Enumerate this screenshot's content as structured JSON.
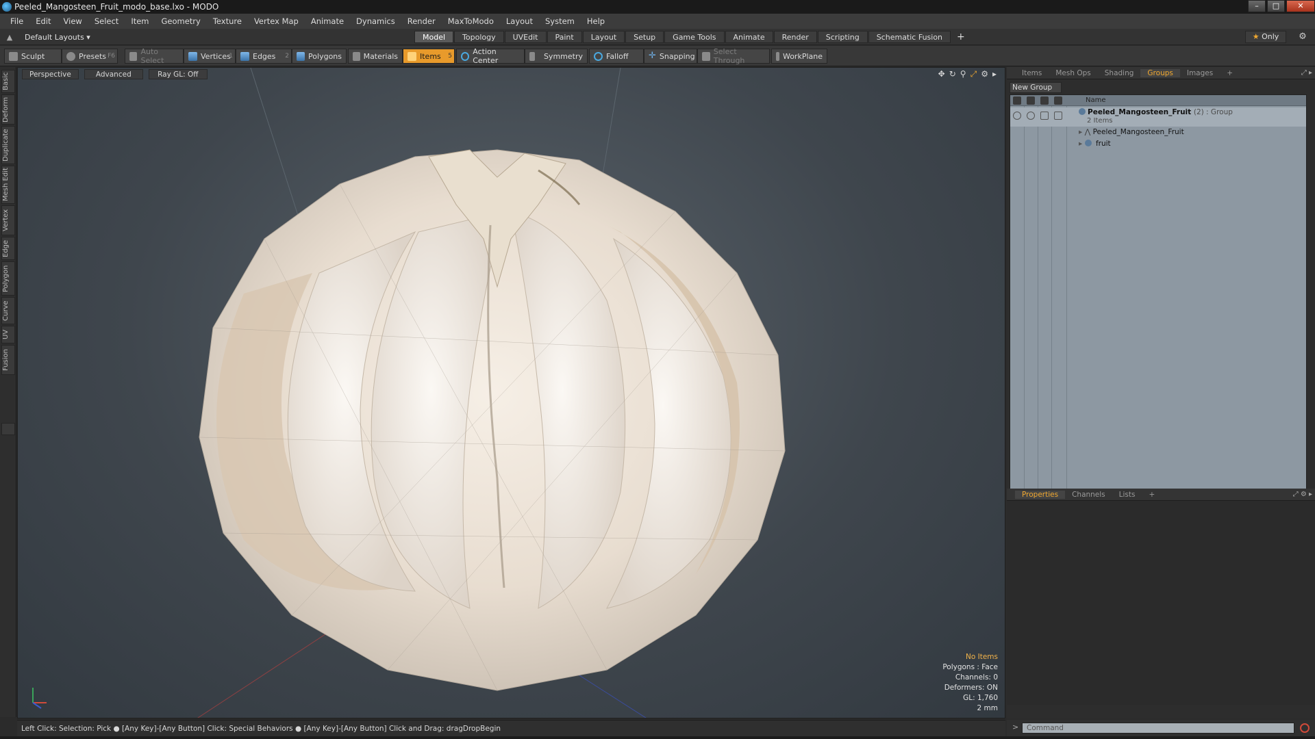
{
  "window": {
    "title": "Peeled_Mangosteen_Fruit_modo_base.lxo - MODO",
    "minimize": "–",
    "maximize": "□",
    "close": "✕"
  },
  "menu": [
    "File",
    "Edit",
    "View",
    "Select",
    "Item",
    "Geometry",
    "Texture",
    "Vertex Map",
    "Animate",
    "Dynamics",
    "Render",
    "MaxToModo",
    "Layout",
    "System",
    "Help"
  ],
  "layout": {
    "dropdown": "Default Layouts ▾",
    "tabs": [
      "Model",
      "Topology",
      "UVEdit",
      "Paint",
      "Layout",
      "Setup",
      "Game Tools",
      "Animate",
      "Render",
      "Scripting",
      "Schematic Fusion"
    ],
    "active_tab": "Model",
    "plus": "+",
    "only": "Only",
    "only_star": "★",
    "gear": "⚙"
  },
  "toolbar": {
    "sculpt": "Sculpt",
    "presets": "Presets",
    "presets_key": "F6",
    "auto_select": "Auto Select",
    "vertices": "Vertices",
    "vertices_num": "1",
    "edges": "Edges",
    "edges_num": "2",
    "polygons": "Polygons",
    "materials": "Materials",
    "items": "Items",
    "items_num": "5",
    "action_center": "Action Center",
    "symmetry": "Symmetry",
    "falloff": "Falloff",
    "snapping": "Snapping",
    "select_through": "Select Through",
    "workplane": "WorkPlane"
  },
  "left_tabs": [
    "Basic",
    "Deform",
    "Duplicate",
    "Mesh Edit",
    "Vertex",
    "Edge",
    "Polygon",
    "Curve",
    "UV",
    "Fusion"
  ],
  "viewport": {
    "view": "Perspective",
    "shading": "Advanced",
    "raygl": "Ray GL: Off",
    "info": {
      "no_items": "No Items",
      "polygons": "Polygons : Face",
      "channels": "Channels: 0",
      "deformers": "Deformers: ON",
      "gl": "GL: 1,760",
      "scale": "2 mm"
    }
  },
  "panel_top": {
    "tabs": [
      "Items",
      "Mesh Ops",
      "Shading",
      "Groups",
      "Images"
    ],
    "active_tab": "Groups",
    "plus": "+",
    "new_group": "New Group",
    "name_header": "Name",
    "tree": {
      "group_name": "Peeled_Mangosteen_Fruit",
      "group_suffix": "(2) : Group",
      "group_count": "2 Items",
      "children": [
        "Peeled_Mangosteen_Fruit",
        "fruit"
      ]
    }
  },
  "panel_bottom": {
    "tabs": [
      "Properties",
      "Channels",
      "Lists"
    ],
    "active_tab": "Properties",
    "plus": "+"
  },
  "status": {
    "text": "Left Click: Selection: Pick ●  [Any Key]-[Any Button] Click: Special Behaviors ●  [Any Key]-[Any Button] Click and Drag: dragDropBegin"
  },
  "command": {
    "arrow": ">",
    "placeholder": "Command"
  }
}
